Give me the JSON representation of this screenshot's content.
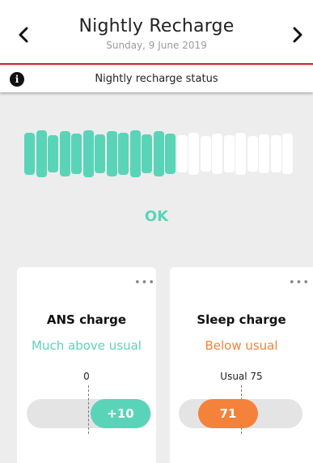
{
  "header": {
    "title": "Nightly Recharge",
    "date": "Sunday, 9 June 2019",
    "prev_icon": "chevron-left-icon",
    "next_icon": "chevron-right-icon"
  },
  "info_bar": {
    "icon": "info-icon",
    "icon_glyph": "i",
    "text": "Nightly recharge status"
  },
  "recharge": {
    "status": "OK",
    "filled_segments": 13,
    "total_segments": 23,
    "filled_color": "#5ad4b8",
    "empty_color": "#ffffff"
  },
  "cards": [
    {
      "title": "ANS charge",
      "status": "Much above usual",
      "status_color": "#5ad4b8",
      "reference_label": "0",
      "value_label": "+10",
      "pill_color": "#5ad4b8",
      "menu_icon": "more-options-icon",
      "menu_glyph": "•••"
    },
    {
      "title": "Sleep charge",
      "status": "Below usual",
      "status_color": "#f5823a",
      "reference_label": "Usual 75",
      "value_label": "71",
      "pill_color": "#f5823a",
      "menu_icon": "more-options-icon",
      "menu_glyph": "•••"
    }
  ],
  "colors": {
    "accent_red": "#d2232a",
    "background": "#ededed"
  }
}
